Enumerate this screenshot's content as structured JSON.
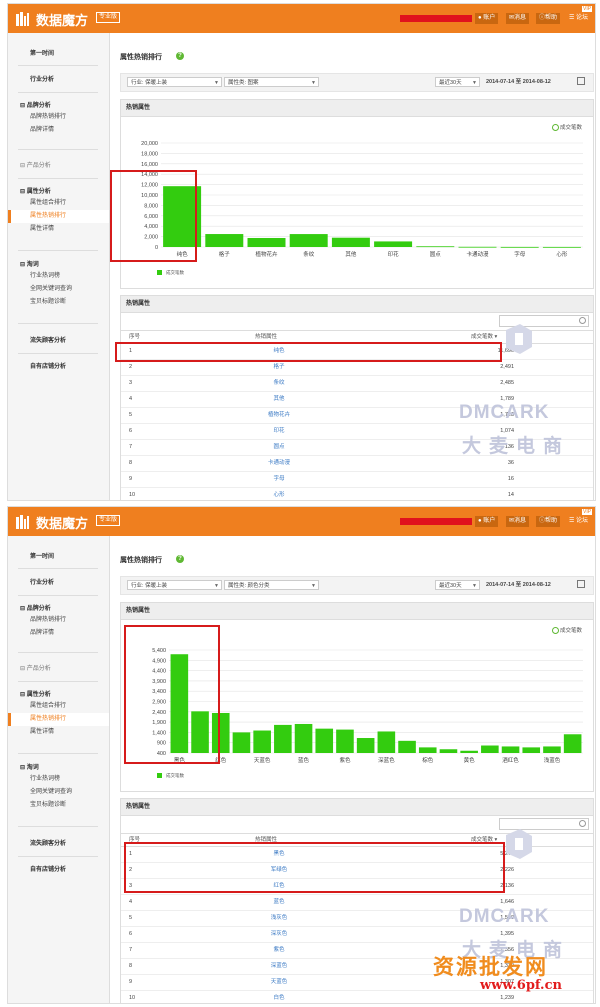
{
  "colors": {
    "brand": "#ef7f1f",
    "bar": "#33cc0f",
    "link": "#3a79c4",
    "highlight": "#d61b1b"
  },
  "app": {
    "title": "数据魔方",
    "badge": "专业版",
    "user_btn": "账户",
    "msg_btn": "消息",
    "help_btn": "帮助",
    "vip_btn": "论坛",
    "vip_badge": "VIP"
  },
  "sidebar": {
    "first_period": "第一时间",
    "industry": "行业分析",
    "brand": {
      "label": "品牌分析",
      "items": [
        "品牌热销排行",
        "品牌详情"
      ]
    },
    "product": {
      "label": "产品分析"
    },
    "attribute": {
      "label": "属性分析",
      "items": [
        "属性组合排行",
        "属性热销排行",
        "属性详情"
      ]
    },
    "search": {
      "label": "淘词",
      "items": [
        "行业热词榜",
        "全网关键词查询",
        "宝贝标题诊断"
      ]
    },
    "lost_customers": "流失顾客分析",
    "own_store": "自有店铺分析"
  },
  "page": {
    "title": "属性热销排行",
    "help_icon": "?"
  },
  "screens": [
    {
      "filters": {
        "industry": "行业: 保暖上装",
        "attribute": "属性类: 图案",
        "period": "最近30天",
        "date_range": "2014-07-14 至 2014-08-12"
      },
      "chart_panel_title": "热销属性",
      "chart_legend_top": "成交笔数",
      "table_panel_title": "热销属性",
      "columns": {
        "rank": "序号",
        "attr": "热销属性",
        "count": "成交笔数"
      },
      "rows": [
        {
          "rank": "1",
          "attr": "纯色",
          "count": "11,696"
        },
        {
          "rank": "2",
          "attr": "格子",
          "count": "2,491"
        },
        {
          "rank": "3",
          "attr": "条纹",
          "count": "2,485"
        },
        {
          "rank": "4",
          "attr": "其他",
          "count": "1,789"
        },
        {
          "rank": "5",
          "attr": "植物花卉",
          "count": "1,728"
        },
        {
          "rank": "6",
          "attr": "印花",
          "count": "1,074"
        },
        {
          "rank": "7",
          "attr": "圆点",
          "count": "136"
        },
        {
          "rank": "8",
          "attr": "卡通动漫",
          "count": "36"
        },
        {
          "rank": "9",
          "attr": "字母",
          "count": "16"
        },
        {
          "rank": "10",
          "attr": "心形",
          "count": "14"
        }
      ],
      "chart_data": {
        "type": "bar",
        "categories": [
          "纯色",
          "格子",
          "植物花卉",
          "条纹",
          "其他",
          "印花",
          "圆点",
          "卡通动漫",
          "字母",
          "心形"
        ],
        "category_labels": [
          "纯色",
          "格子",
          "植物花卉",
          "条纹",
          "其他",
          "印花",
          "圆点",
          "卡通动漫",
          "字母",
          "心形"
        ],
        "series": [
          {
            "name": "成交笔数",
            "values": [
              11696,
              2491,
              1728,
              2485,
              1789,
              1074,
              136,
              36,
              16,
              14
            ]
          }
        ],
        "yticks": [
          "20,000",
          "18,000",
          "16,000",
          "14,000",
          "12,000",
          "10,000",
          "8,000",
          "6,000",
          "4,000",
          "2,000",
          "0"
        ],
        "ylim": [
          0,
          20000
        ],
        "grid": true,
        "legend_placement": "bottom-left"
      }
    },
    {
      "filters": {
        "industry": "行业: 保暖上装",
        "attribute": "属性类: 颜色分类",
        "period": "最近30天",
        "date_range": "2014-07-14 至 2014-08-12"
      },
      "chart_panel_title": "热销属性",
      "chart_legend_top": "成交笔数",
      "table_panel_title": "热销属性",
      "columns": {
        "rank": "序号",
        "attr": "热销属性",
        "count": "成交笔数"
      },
      "rows": [
        {
          "rank": "1",
          "attr": "黑色",
          "count": "5,274"
        },
        {
          "rank": "2",
          "attr": "军绿色",
          "count": "2,226"
        },
        {
          "rank": "3",
          "attr": "红色",
          "count": "2,136"
        },
        {
          "rank": "4",
          "attr": "蓝色",
          "count": "1,646"
        },
        {
          "rank": "5",
          "attr": "浅灰色",
          "count": "1,589"
        },
        {
          "rank": "6",
          "attr": "深灰色",
          "count": "1,395"
        },
        {
          "rank": "7",
          "attr": "紫色",
          "count": "1,356"
        },
        {
          "rank": "8",
          "attr": "深蓝色",
          "count": "1,339"
        },
        {
          "rank": "9",
          "attr": "天蓝色",
          "count": "1,307"
        },
        {
          "rank": "10",
          "attr": "白色",
          "count": "1,239"
        }
      ],
      "chart_data": {
        "type": "bar",
        "categories": [
          "黑色",
          "军绿色",
          "红色",
          "c4",
          "天蓝色",
          "c6",
          "蓝色",
          "c8",
          "紫色",
          "c10",
          "深蓝色",
          "c12",
          "棕色",
          "c14",
          "黄色",
          "c16",
          "酒红色",
          "c18",
          "浅蓝色",
          "c20"
        ],
        "category_labels": [
          "黑色",
          "",
          "红色",
          "",
          "天蓝色",
          "",
          "蓝色",
          "",
          "紫色",
          "",
          "深蓝色",
          "",
          "棕色",
          "",
          "黄色",
          "",
          "酒红色",
          "",
          "浅蓝色",
          ""
        ],
        "series": [
          {
            "name": "成交笔数",
            "values": [
              5274,
              2226,
              2136,
              1100,
              1200,
              1500,
              1550,
              1300,
              1250,
              800,
              1150,
              650,
              300,
              200,
              120,
              400,
              350,
              300,
              350,
              1000
            ]
          }
        ],
        "yticks": [
          "5,400",
          "4,900",
          "4,400",
          "3,900",
          "3,400",
          "2,900",
          "2,400",
          "1,900",
          "1,400",
          "900",
          "400"
        ],
        "ylim": [
          0,
          5500
        ],
        "grid": true,
        "legend_placement": "bottom-left"
      }
    }
  ],
  "watermark": {
    "en": "DMCARK",
    "cn": "大麦电商",
    "source": "资源批发网",
    "url": "www.6pf.cn"
  }
}
